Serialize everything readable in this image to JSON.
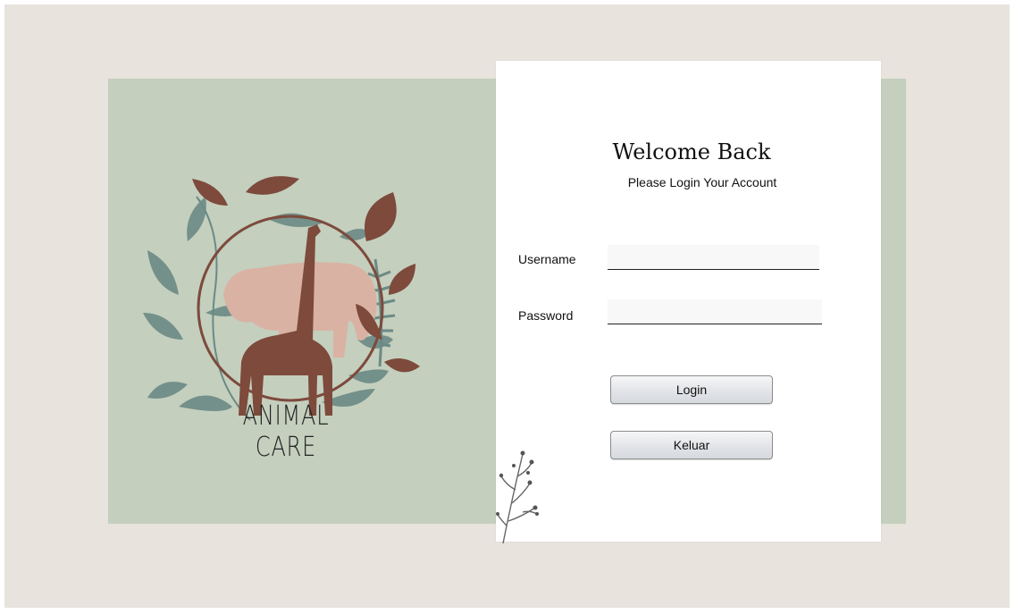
{
  "brand": {
    "name": "ANIMAL CARE"
  },
  "login": {
    "title": "Welcome Back",
    "subtitle": "Please Login Your Account",
    "username_label": "Username",
    "username_value": "",
    "password_label": "Password",
    "password_value": "",
    "login_button": "Login",
    "exit_button": "Keluar"
  },
  "colors": {
    "frame_bg": "#e8e3dd",
    "panel_green": "#c4cfbe",
    "leaf_brown": "#7d4a3c",
    "leaf_teal": "#6b8a85",
    "elephant_pink": "#d9b2a3"
  },
  "icons": [
    "animal-care-logo",
    "plant-sprig-decoration"
  ]
}
